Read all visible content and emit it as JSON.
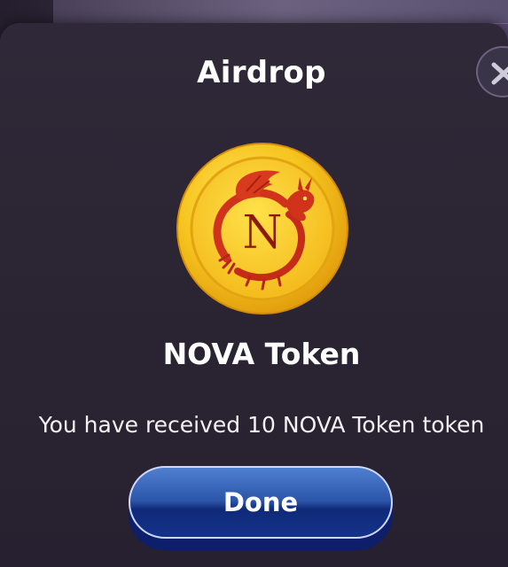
{
  "modal": {
    "title": "Airdrop",
    "close_icon": "close-icon",
    "token_name": "NOVA Token",
    "message": "You have received 10 NOVA Token token",
    "done_label": "Done",
    "coin": {
      "icon": "nova-dragon-coin-logo",
      "letter": "N",
      "colors": {
        "gold": "#f4c21f",
        "rim": "#e0a110",
        "dragon": "#d0321c"
      }
    }
  },
  "colors": {
    "backdrop": "#2a2435",
    "button_top": "#4f7fd0",
    "button_bottom": "#15328a",
    "text": "#ffffff"
  }
}
